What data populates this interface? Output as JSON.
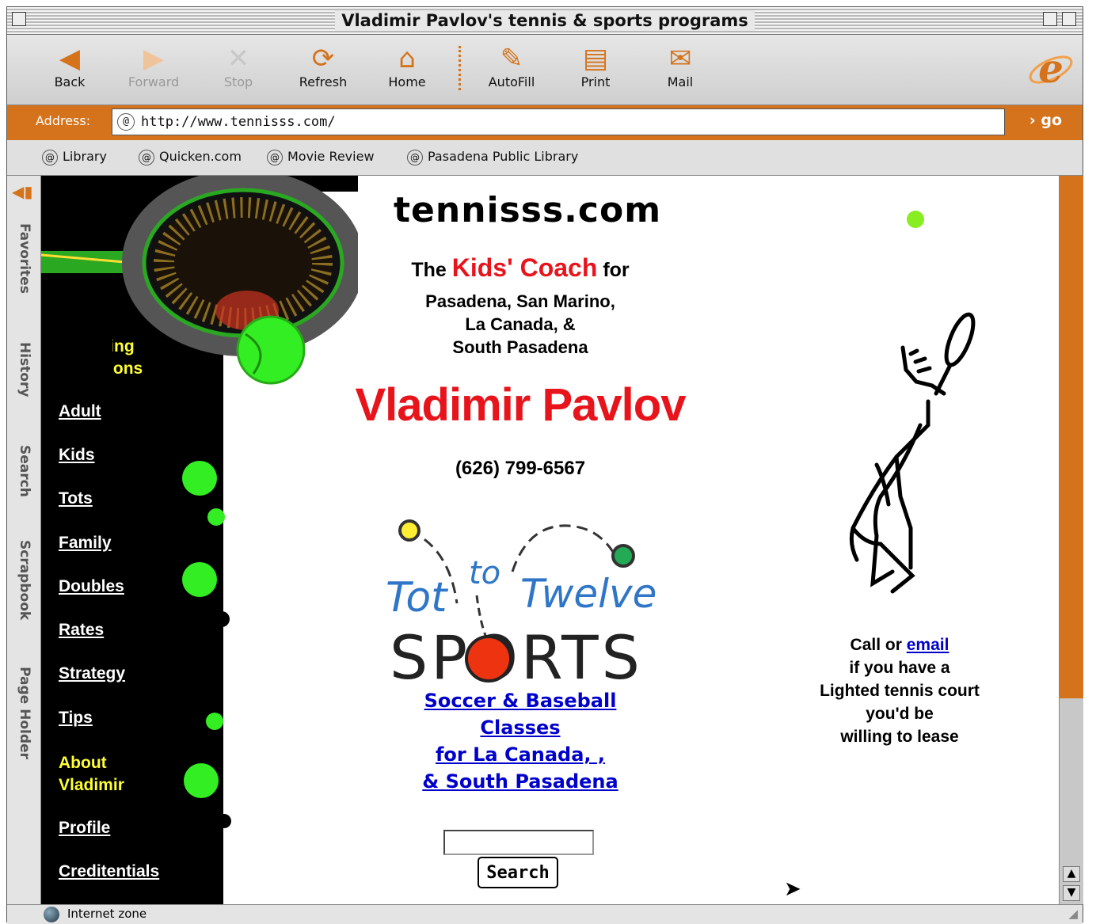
{
  "window": {
    "title": "Vladimir Pavlov's tennis & sports programs"
  },
  "toolbar": {
    "back": "Back",
    "forward": "Forward",
    "stop": "Stop",
    "refresh": "Refresh",
    "home": "Home",
    "autofill": "AutoFill",
    "print": "Print",
    "mail": "Mail"
  },
  "address": {
    "label": "Address:",
    "url": "http://www.tennisss.com/",
    "go": "go"
  },
  "favorites": [
    "Library",
    "Quicken.com",
    "Movie Review",
    "Pasadena Public Library"
  ],
  "sidetabs": [
    "Favorites",
    "History",
    "Search",
    "Scrapbook",
    "Page Holder"
  ],
  "status": {
    "zone": "Internet zone"
  },
  "nav": {
    "coaching_heading": [
      "Coaching",
      "& Lessons"
    ],
    "coaching_links": [
      "Adult",
      "Kids",
      "Tots",
      "Family",
      "Doubles",
      "Rates",
      "Strategy",
      "Tips"
    ],
    "about_heading": [
      "About",
      "Vladimir"
    ],
    "about_links": [
      "Profile",
      "Creditentials"
    ]
  },
  "main": {
    "site_name": "tennisss.com",
    "tagline_the": "The",
    "tagline_kids_coach": "Kids' Coach",
    "tagline_for": "for",
    "areas": [
      "Pasadena, San Marino,",
      "La Canada, &",
      "South Pasadena"
    ],
    "coach_name": "Vladimir Pavlov",
    "phone": "(626) 799-6567",
    "logo_tot": "Tot",
    "logo_to": "to",
    "logo_twelve": "Twelve",
    "logo_sports": "SPORTS",
    "classes_links": [
      "Soccer & Baseball",
      "Classes",
      "for La Canada, ,",
      "& South Pasadena"
    ],
    "search_input_value": "",
    "search_button": "Search"
  },
  "right": {
    "call_prefix": "Call or ",
    "email_link": "email",
    "lines": [
      "if you have a",
      "Lighted tennis court",
      "you'd be",
      "willing to lease"
    ]
  },
  "colors": {
    "accent_orange": "#d4731c",
    "brand_red": "#e8141c",
    "ball_green": "#33ee22",
    "nav_yellow": "#ffff33",
    "link_blue": "#0000cc"
  }
}
